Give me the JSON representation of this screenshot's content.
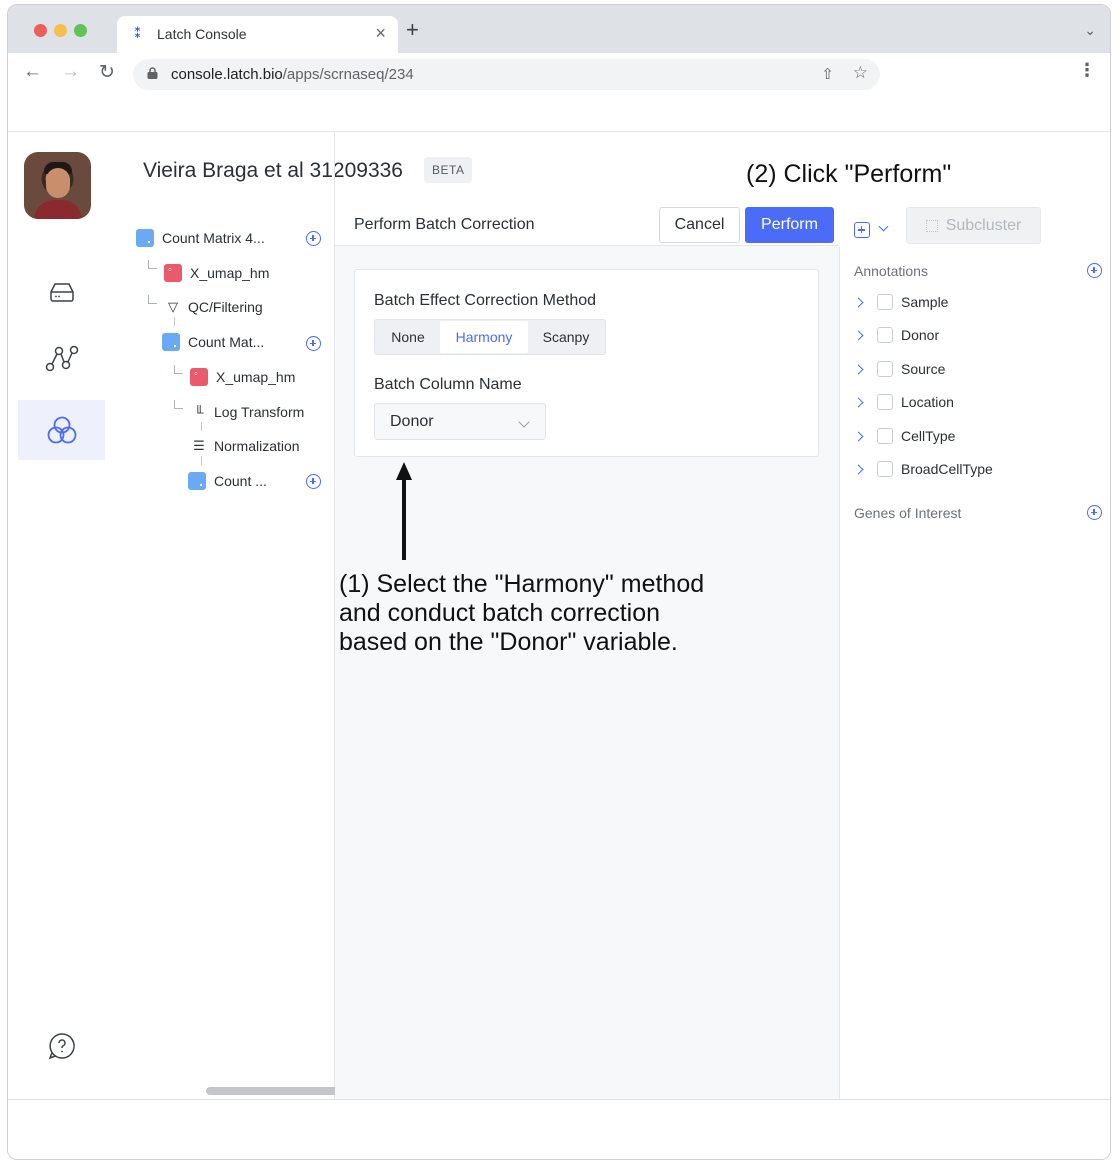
{
  "browser": {
    "tab_title": "Latch Console",
    "url_host": "console.latch.bio",
    "url_path": "/apps/scrnaseq/234"
  },
  "project": {
    "title": "Vieira Braga et al 31209336",
    "badge": "BETA"
  },
  "rail": {
    "items": [
      "drive-icon",
      "graph-icon",
      "cells-icon",
      "help-icon"
    ],
    "active": "cells-icon"
  },
  "tree": {
    "nodes": [
      {
        "label": "Count Matrix 4...",
        "icon": "matrix-icon",
        "addable": true
      },
      {
        "label": "X_umap_hm",
        "icon": "umap-icon"
      },
      {
        "label": "QC/Filtering",
        "icon": "filter-icon"
      },
      {
        "label": "Count Mat...",
        "icon": "matrix-icon",
        "addable": true
      },
      {
        "label": "X_umap_hm",
        "icon": "umap-icon"
      },
      {
        "label": "Log Transform",
        "icon": "bar-chart-icon"
      },
      {
        "label": "Normalization",
        "icon": "list-icon"
      },
      {
        "label": "Count ...",
        "icon": "matrix-icon",
        "addable": true
      }
    ]
  },
  "panel": {
    "title": "Perform Batch Correction",
    "cancel_label": "Cancel",
    "perform_label": "Perform",
    "method_label": "Batch Effect Correction Method",
    "method_options": [
      "None",
      "Harmony",
      "Scanpy"
    ],
    "method_selected": "Harmony",
    "column_label": "Batch Column Name",
    "column_value": "Donor"
  },
  "toolbar": {
    "subcluster_label": "Subcluster",
    "subcluster_disabled": true
  },
  "annotations": {
    "title": "Annotations",
    "items": [
      "Sample",
      "Donor",
      "Source",
      "Location",
      "CellType",
      "BroadCellType"
    ],
    "genes_title": "Genes of Interest"
  },
  "overlay": {
    "step2": "(2) Click \"Perform\"",
    "step1_lines": [
      "(1) Select the \"Harmony\" method",
      "and conduct batch correction",
      "based on the \"Donor\" variable."
    ]
  },
  "colors": {
    "accent": "#4a6cf7",
    "active_rail_bg": "#eef1fb",
    "matrix_icon": "#6aaaf2",
    "umap_icon": "#ea5a6c"
  }
}
